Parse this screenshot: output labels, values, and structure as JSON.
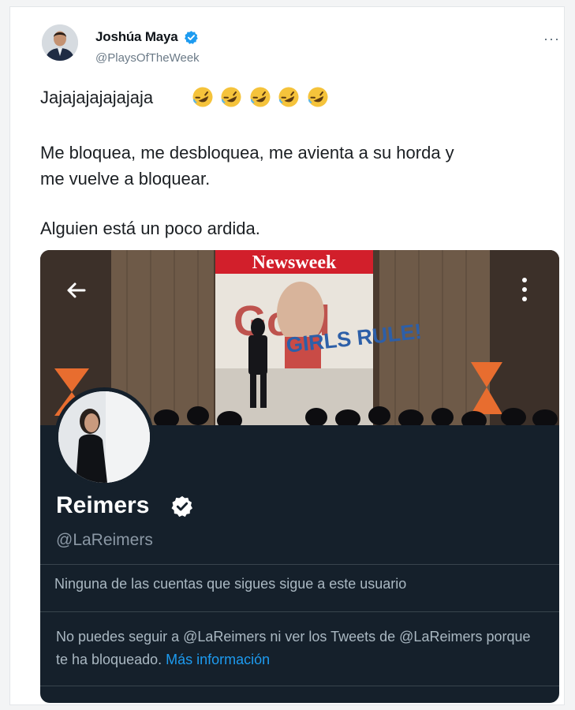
{
  "tweet": {
    "author_name": "Joshúa Maya",
    "author_handle": "@PlaysOfTheWeek",
    "more_glyph": "···",
    "line1": "Jajajajajajajaja",
    "emoji_count": 5,
    "line2a": "Me bloquea, me desbloquea, me avienta a su horda y",
    "line2b": "me vuelve a bloquear.",
    "line3": "Alguien está un poco ardida."
  },
  "embed": {
    "banner_magazine": "Newsweek",
    "banner_slogan": "GIRLS RULE!",
    "banner_bg_word": "Gold",
    "profile_name": "Reimers",
    "profile_handle": "@LaReimers",
    "followers_note": "Ninguna de las cuentas que sigues sigue a este usuario",
    "blocked_text": "No puedes seguir a @LaReimers ni ver los Tweets de @LaReimers porque te ha bloqueado.",
    "more_info_link": "Más información"
  },
  "icons": {
    "verified": "verified-badge-icon",
    "back": "back-arrow-icon",
    "menu": "more-vertical-icon",
    "emoji": "rolling-on-floor-laughing-emoji"
  },
  "colors": {
    "verified": "#1d9bf0",
    "link": "#1d9bf0",
    "embed_bg": "#15202b",
    "emoji": "#f5c33b"
  }
}
